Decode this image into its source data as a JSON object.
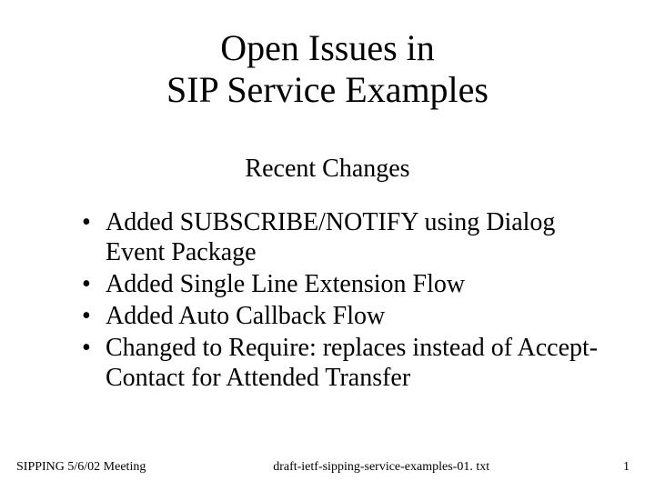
{
  "title_line1": "Open Issues in",
  "title_line2": "SIP Service Examples",
  "subtitle": "Recent Changes",
  "bullets": [
    "Added SUBSCRIBE/NOTIFY  using Dialog Event Package",
    "Added Single Line Extension Flow",
    "Added Auto Callback Flow",
    "Changed to Require: replaces instead of Accept-Contact for Attended Transfer"
  ],
  "footer": {
    "left": "SIPPING 5/6/02 Meeting",
    "center": "draft-ietf-sipping-service-examples-01. txt",
    "page": "1"
  }
}
